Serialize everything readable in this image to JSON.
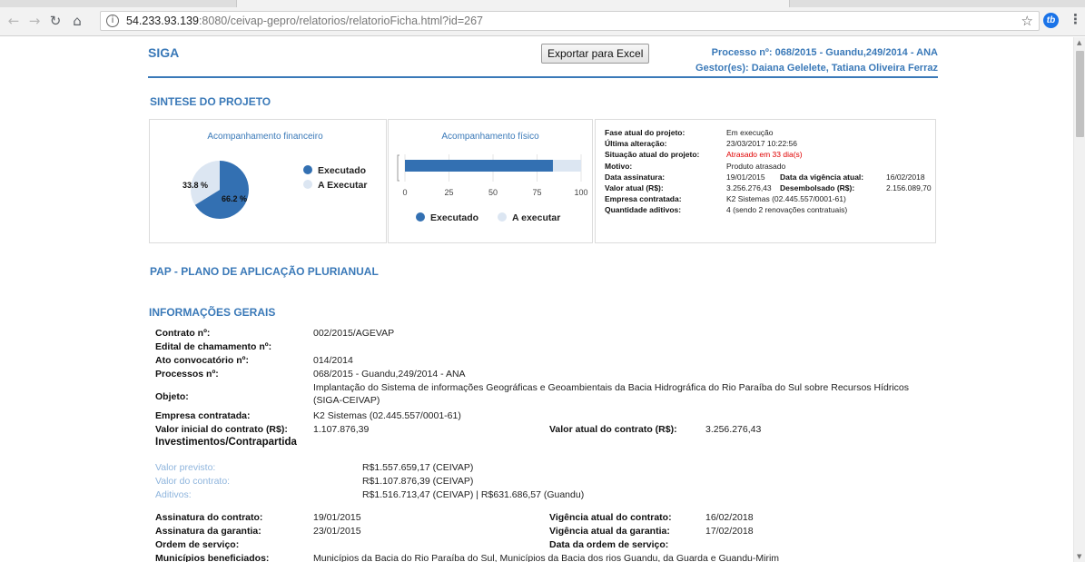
{
  "browser": {
    "url_host": "54.233.93.139",
    "url_rest": ":8080/ceivap-gepro/relatorios/relatorioFicha.html?id=267",
    "ext_label": "tb"
  },
  "header": {
    "brand": "SIGA",
    "export_label": "Exportar para Excel",
    "process": "Processo nº: 068/2015 - Guandu,249/2014 - ANA",
    "managers": "Gestor(es): Daiana Gelelete, Tatiana Oliveira Ferraz"
  },
  "sections": {
    "sintese": "SINTESE DO PROJETO",
    "pap": "PAP - PLANO DE APLICAÇÃO PLURIANUAL",
    "info": "INFORMAÇÕES GERAIS"
  },
  "financial": {
    "title": "Acompanhamento financeiro",
    "executed_label": "66.2 %",
    "remaining_label": "33.8 %",
    "legend_executed": "Executado",
    "legend_remaining": "A Executar"
  },
  "physical": {
    "title": "Acompanhamento físico",
    "ticks": [
      "0",
      "25",
      "50",
      "75",
      "100"
    ],
    "legend_executed": "Executado",
    "legend_remaining": "A executar"
  },
  "chart_data": [
    {
      "type": "pie",
      "title": "Acompanhamento financeiro",
      "labels": [
        "Executado",
        "A Executar"
      ],
      "values": [
        66.2,
        33.8
      ],
      "colors": [
        "#3370b2",
        "#dce6f2"
      ],
      "legend": "right"
    },
    {
      "type": "bar",
      "title": "Acompanhamento físico",
      "orientation": "horizontal",
      "series": [
        {
          "name": "Executado",
          "values": [
            84
          ]
        },
        {
          "name": "A executar",
          "values": [
            16
          ]
        }
      ],
      "xlim": [
        0,
        100
      ],
      "xticks": [
        0,
        25,
        50,
        75,
        100
      ],
      "colors": [
        "#3370b2",
        "#dce6f2"
      ],
      "legend": "bottom"
    }
  ],
  "status": {
    "fase_k": "Fase atual do projeto:",
    "fase_v": "Em execução",
    "alt_k": "Última alteração:",
    "alt_v": "23/03/2017 10:22:56",
    "sit_k": "Situação atual do projeto:",
    "sit_v": "Atrasado em 33 dia(s)",
    "mot_k": "Motivo:",
    "mot_v": "Produto atrasado",
    "ass_k": "Data assinatura:",
    "ass_v": "19/01/2015",
    "vig_k": "Data da vigência atual:",
    "vig_v": "16/02/2018",
    "val_k": "Valor atual (R$):",
    "val_v": "3.256.276,43",
    "des_k": "Desembolsado (R$):",
    "des_v": "2.156.089,70",
    "emp_k": "Empresa contratada:",
    "emp_v": "K2 Sistemas (02.445.557/0001-61)",
    "adi_k": "Quantidade aditivos:",
    "adi_v": "4 (sendo 2 renovações contratuais)"
  },
  "info": {
    "contrato_k": "Contrato nº:",
    "contrato_v": "002/2015/AGEVAP",
    "edital_k": "Edital de chamamento nº:",
    "ato_k": "Ato convocatório nº:",
    "ato_v": "014/2014",
    "proc_k": "Processos nº:",
    "proc_v": "068/2015 - Guandu,249/2014 - ANA",
    "obj_k": "Objeto:",
    "obj_v": "Implantação do Sistema de informações Geográficas e Geoambientais da Bacia Hidrográfica do Rio Paraíba do Sul sobre Recursos Hídricos (SIGA-CEIVAP)",
    "emp_k": "Empresa contratada:",
    "emp_v": "K2 Sistemas (02.445.557/0001-61)",
    "vini_k": "Valor inicial do contrato (R$):",
    "vini_v": "1.107.876,39",
    "vatual_k": "Valor atual do contrato (R$):",
    "vatual_v": "3.256.276,43",
    "invest": "Investimentos/Contrapartida",
    "prev_k": "Valor previsto:",
    "prev_v": "R$1.557.659,17 (CEIVAP)",
    "vcont_k": "Valor do contrato:",
    "vcont_v": "R$1.107.876,39 (CEIVAP)",
    "adit_k": "Aditivos:",
    "adit_v": "R$1.516.713,47 (CEIVAP) | R$631.686,57 (Guandu)",
    "asscont_k": "Assinatura do contrato:",
    "asscont_v": "19/01/2015",
    "vigcont_k": "Vigência atual do contrato:",
    "vigcont_v": "16/02/2018",
    "assgar_k": "Assinatura da garantia:",
    "assgar_v": "23/01/2015",
    "viggar_k": "Vigência atual da garantia:",
    "viggar_v": "17/02/2018",
    "ordem_k": "Ordem de serviço:",
    "dataordem_k": "Data da ordem de serviço:",
    "mun_k": "Municípios beneficiados:",
    "mun_v": "Municípios da Bacia do Rio Paraíba do Sul, Municípios da Bacia dos rios Guandu, da Guarda e Guandu-Mirim"
  }
}
